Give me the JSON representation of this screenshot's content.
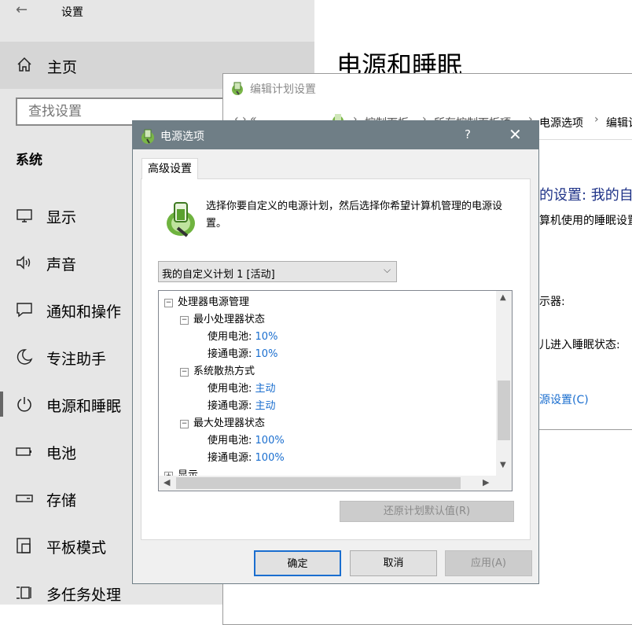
{
  "settings": {
    "window_title": "设置",
    "home_label": "主页",
    "search_placeholder": "查找设置",
    "section_title": "系统",
    "nav_items": [
      {
        "label": "显示",
        "icon": "display-icon"
      },
      {
        "label": "声音",
        "icon": "sound-icon"
      },
      {
        "label": "通知和操作",
        "icon": "notification-icon"
      },
      {
        "label": "专注助手",
        "icon": "moon-icon"
      },
      {
        "label": "电源和睡眠",
        "icon": "power-icon"
      },
      {
        "label": "电池",
        "icon": "battery-icon"
      },
      {
        "label": "存储",
        "icon": "storage-icon"
      },
      {
        "label": "平板模式",
        "icon": "tablet-icon"
      },
      {
        "label": "多任务处理",
        "icon": "multitask-icon"
      }
    ],
    "active_item": "电源和睡眠",
    "page_title": "电源和睡眠"
  },
  "edit_plan": {
    "window_title": "编辑计划设置",
    "breadcrumbs": [
      "控制面板",
      "所有控制面板项",
      "电源选项",
      "编辑计"
    ],
    "heading": "的设置: 我的自",
    "description": "算机使用的睡眠设置",
    "label_display": "示器:",
    "label_sleep": "儿进入睡眠状态:",
    "link_advanced": "源设置(C)"
  },
  "dialog": {
    "title": "电源选项",
    "help": "?",
    "tab": "高级设置",
    "description": "选择你要自定义的电源计划，然后选择你希望计算机管理的电源设置。",
    "plan_selected": "我的自定义计划 1 [活动]",
    "tree": {
      "root": "处理器电源管理",
      "groups": [
        {
          "name": "最小处理器状态",
          "battery_label": "使用电池:",
          "battery_value": "10%",
          "ac_label": "接通电源:",
          "ac_value": "10%"
        },
        {
          "name": "系统散热方式",
          "battery_label": "使用电池:",
          "battery_value": "主动",
          "ac_label": "接通电源:",
          "ac_value": "主动"
        },
        {
          "name": "最大处理器状态",
          "battery_label": "使用电池:",
          "battery_value": "100%",
          "ac_label": "接通电源:",
          "ac_value": "100%"
        }
      ],
      "next_root": "显示"
    },
    "restore_button": "还原计划默认值(R)",
    "ok_button": "确定",
    "cancel_button": "取消",
    "apply_button": "应用(A)"
  },
  "colors": {
    "dialog_titlebar": "#6f7e86",
    "link_blue": "#1a6ecf",
    "sidebar_bg": "#e6e6e6"
  }
}
